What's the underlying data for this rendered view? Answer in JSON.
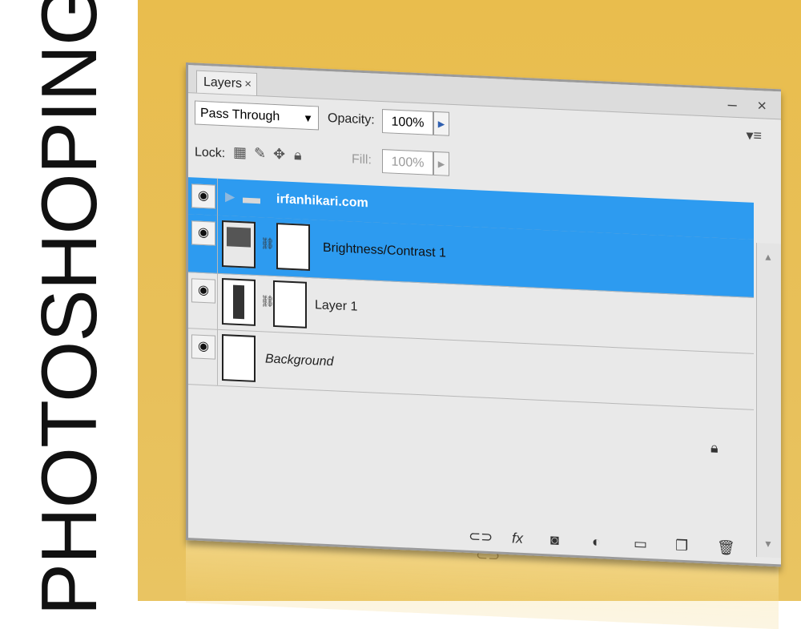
{
  "side_title": "PHOTOSHOPING",
  "panel": {
    "tab_label": "Layers",
    "tab_close": "×",
    "window_buttons": "– ×",
    "blend_mode": "Pass Through",
    "opacity_label": "Opacity:",
    "opacity_value": "100%",
    "lock_label": "Lock:",
    "fill_label": "Fill:",
    "fill_value": "100%",
    "panel_menu": "▾≡"
  },
  "layers": [
    {
      "name": "irfanhikari.com",
      "type": "group",
      "selected": true
    },
    {
      "name": "Brightness/Contrast 1",
      "type": "adjustment",
      "selected": true
    },
    {
      "name": "Layer 1",
      "type": "pixel",
      "selected": false
    },
    {
      "name": "Background",
      "type": "background",
      "selected": false
    }
  ],
  "bottom_icons": [
    "link-icon",
    "fx-icon",
    "mask-icon",
    "adjustment-icon",
    "folder-icon",
    "new-layer-icon",
    "trash-icon"
  ],
  "colors": {
    "accent": "#2d9bf0",
    "background": "#e9bd4d"
  }
}
